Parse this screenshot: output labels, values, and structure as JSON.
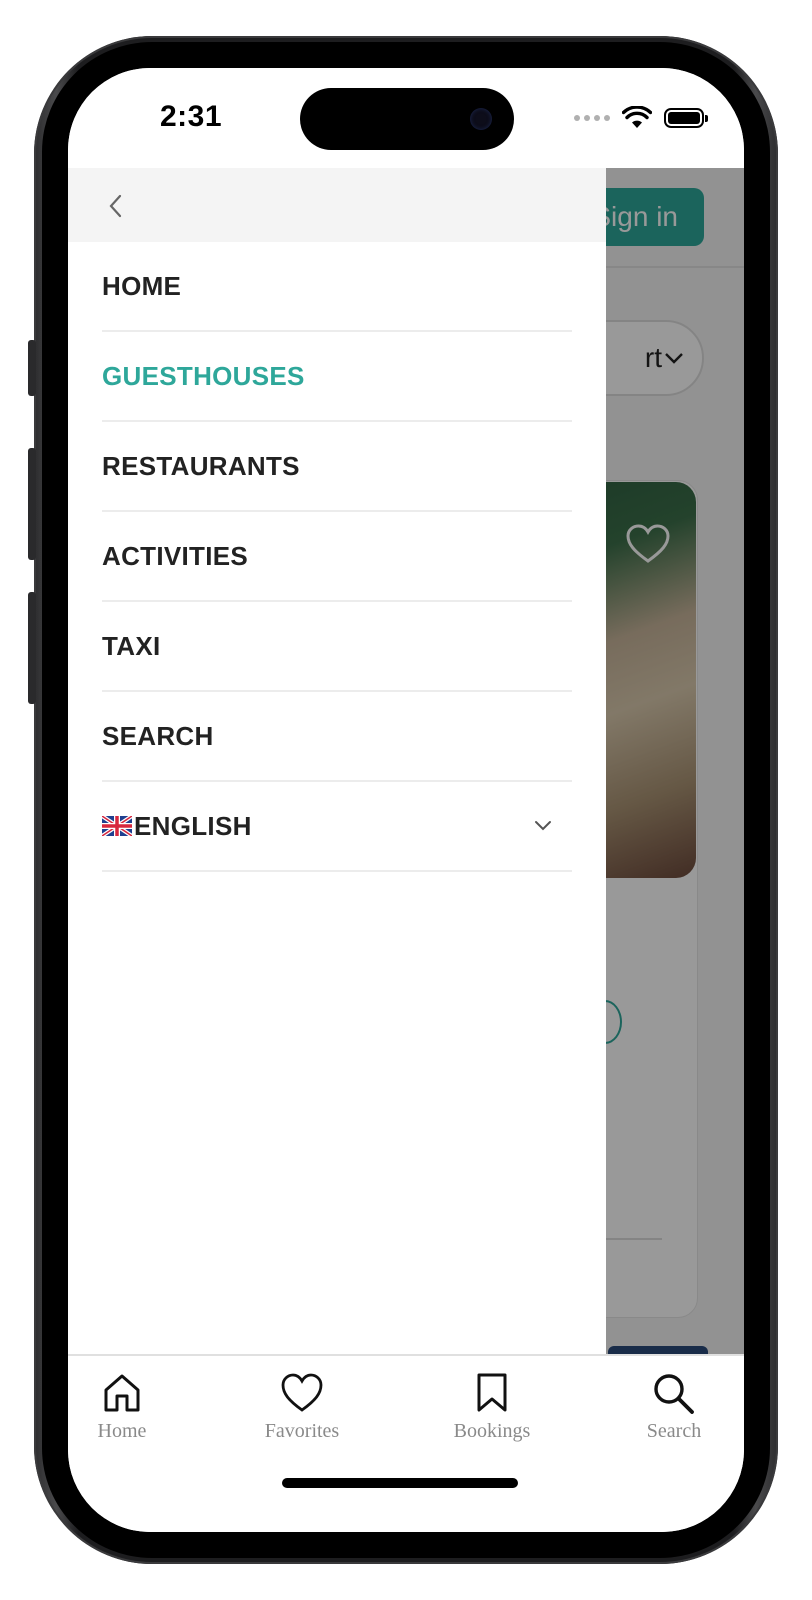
{
  "status_bar": {
    "time": "2:31"
  },
  "background_page": {
    "signin_label": "Sign in",
    "sort_label": "rt"
  },
  "drawer": {
    "menu": [
      {
        "label": "HOME",
        "active": false
      },
      {
        "label": "GUESTHOUSES",
        "active": true
      },
      {
        "label": "RESTAURANTS",
        "active": false
      },
      {
        "label": "ACTIVITIES",
        "active": false
      },
      {
        "label": "TAXI",
        "active": false
      },
      {
        "label": "SEARCH",
        "active": false
      }
    ],
    "language": {
      "label": "ENGLISH",
      "flag": "uk-flag-icon"
    }
  },
  "tabbar": {
    "items": [
      {
        "label": "Home",
        "icon": "home-icon"
      },
      {
        "label": "Favorites",
        "icon": "heart-icon"
      },
      {
        "label": "Bookings",
        "icon": "bookmark-icon"
      },
      {
        "label": "Search",
        "icon": "search-icon"
      }
    ]
  },
  "colors": {
    "accent": "#2ea79a",
    "text": "#222222",
    "tab_label": "#8a8a8a"
  }
}
